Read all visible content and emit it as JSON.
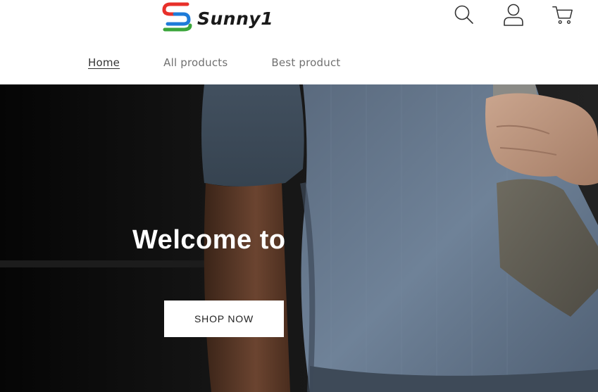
{
  "brand": {
    "name": "Sunny1",
    "colors": {
      "red": "#e8302a",
      "blue": "#1e7bd8",
      "green": "#3aa53a",
      "text": "#1a1a1a"
    }
  },
  "header": {
    "icons": [
      "search-icon",
      "account-icon",
      "cart-icon"
    ]
  },
  "nav": {
    "items": [
      {
        "label": "Home",
        "active": true
      },
      {
        "label": "All products",
        "active": false
      },
      {
        "label": "Best product",
        "active": false
      }
    ]
  },
  "hero": {
    "title": "Welcome to",
    "button_label": "SHOP NOW"
  }
}
